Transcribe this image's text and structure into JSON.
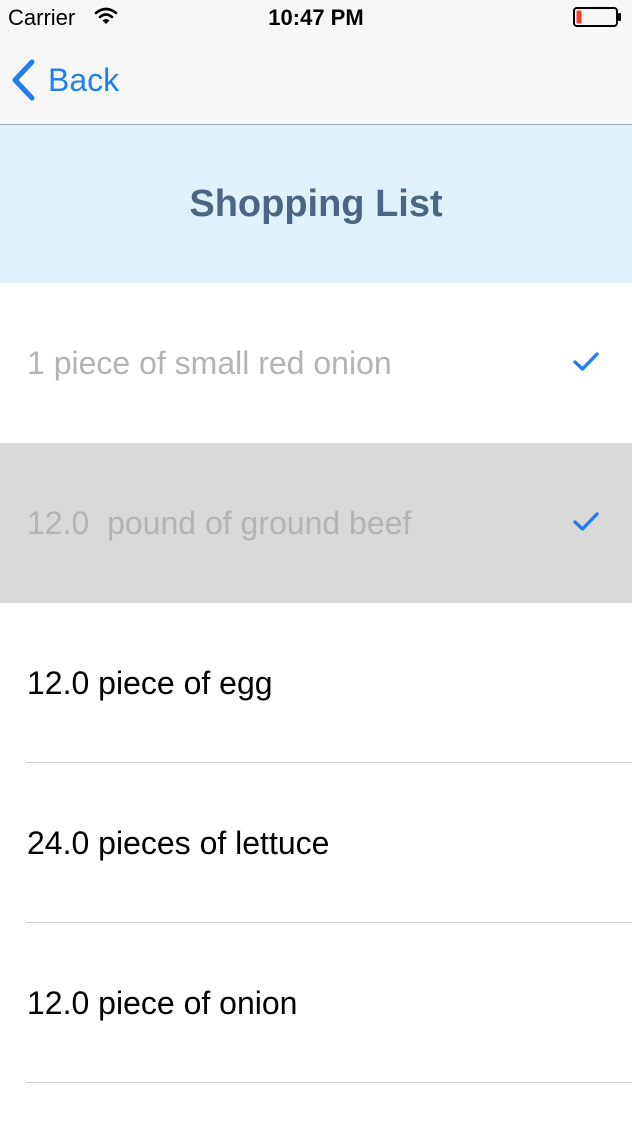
{
  "status_bar": {
    "carrier": "Carrier",
    "time": "10:47 PM",
    "wifi_icon": "wifi-icon",
    "battery_icon": "battery-low-icon"
  },
  "nav": {
    "back_label": "Back",
    "back_icon": "chevron-left-icon"
  },
  "header": {
    "title": "Shopping List"
  },
  "items": [
    {
      "label": "1 piece of small red onion",
      "checked": true,
      "highlighted": false
    },
    {
      "label": "12.0  pound of ground beef",
      "checked": true,
      "highlighted": true
    },
    {
      "label": "12.0 piece of egg",
      "checked": false,
      "highlighted": false
    },
    {
      "label": "24.0 pieces of lettuce",
      "checked": false,
      "highlighted": false
    },
    {
      "label": "12.0 piece of onion",
      "checked": false,
      "highlighted": false
    }
  ],
  "colors": {
    "accent": "#1f7ff2",
    "header_background": "#e0f1fb",
    "header_text": "#4c6485",
    "checked_text": "#b4b4b4",
    "highlight_row": "#d9d9d9",
    "battery_low": "#ff3b30"
  }
}
